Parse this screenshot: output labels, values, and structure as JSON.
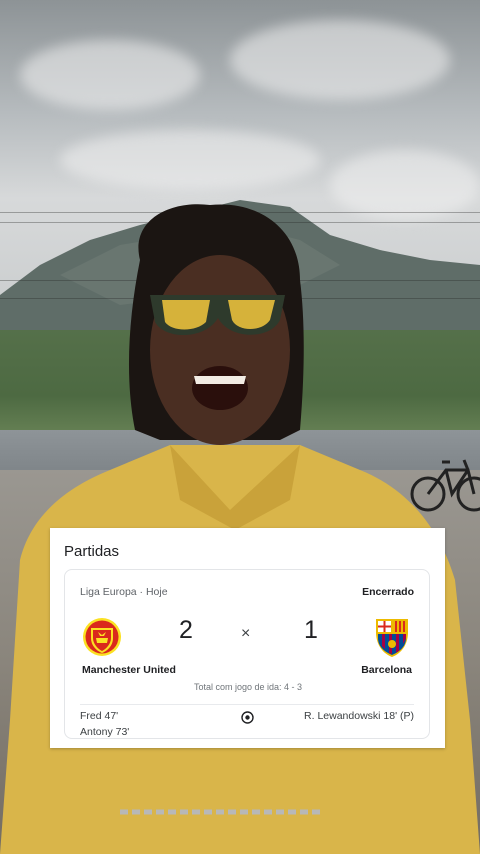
{
  "card": {
    "title": "Partidas",
    "league": "Liga Europa · Hoje",
    "status": "Encerrado",
    "home": {
      "name": "Manchester United",
      "score": "2",
      "scorers": [
        "Fred 47'",
        "Antony 73'"
      ],
      "crest": "manchester-united-crest"
    },
    "away": {
      "name": "Barcelona",
      "score": "1",
      "scorers": [
        "R. Lewandowski 18' (P)"
      ],
      "crest": "barcelona-crest"
    },
    "separator": "×",
    "aggregate": "Total com jogo de ida: 4 - 3"
  },
  "colors": {
    "man_utd_red": "#da291c",
    "man_utd_gold": "#fbe122",
    "barca_blue": "#004d98",
    "barca_garnet": "#a50044",
    "barca_gold": "#edbb00"
  }
}
